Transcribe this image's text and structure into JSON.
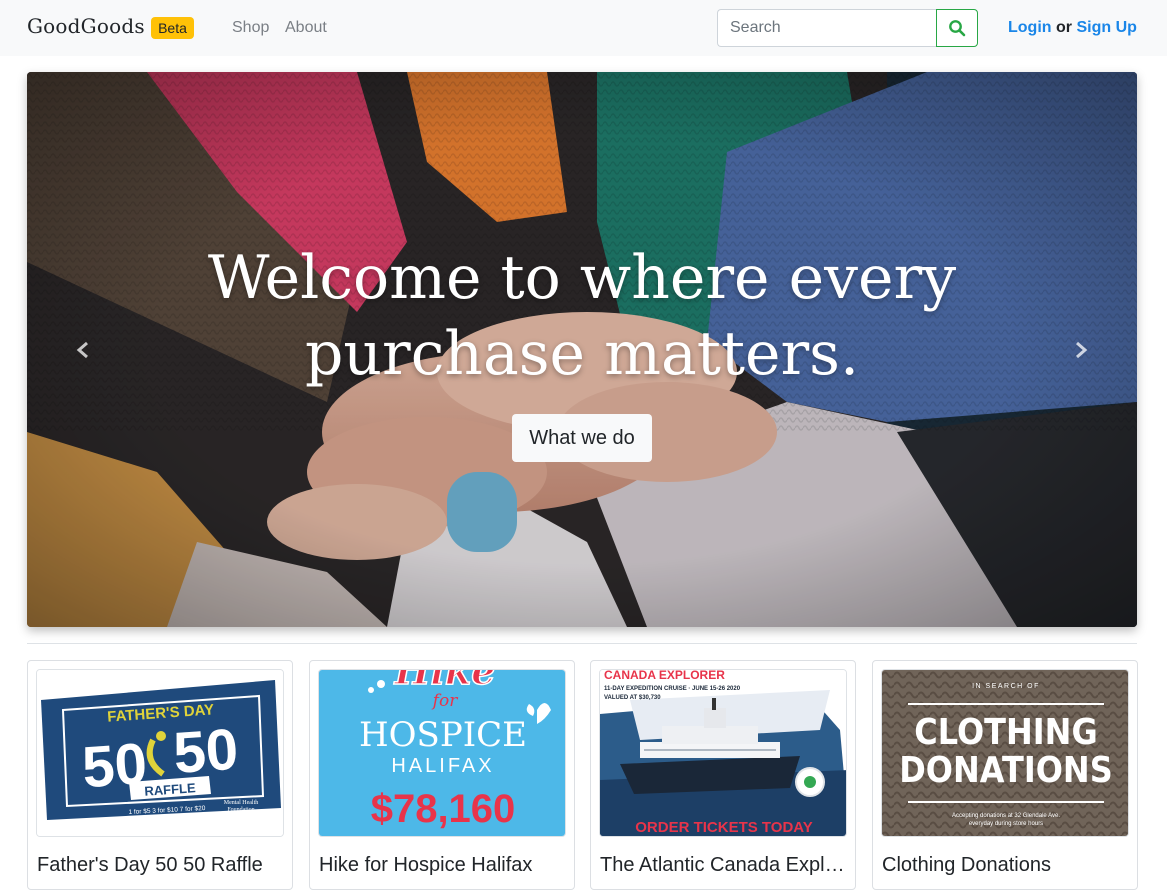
{
  "brand": {
    "name": "GoodGoods",
    "badge": "Beta"
  },
  "nav": {
    "items": [
      {
        "label": "Shop"
      },
      {
        "label": "About"
      }
    ]
  },
  "search": {
    "placeholder": "Search",
    "value": "",
    "button_icon": "search-icon"
  },
  "auth": {
    "login": "Login",
    "or": "or",
    "signup": "Sign Up"
  },
  "hero": {
    "title_line1": "Welcome to where every",
    "title_line2": "purchase matters.",
    "button": "What we do",
    "prev_icon": "chevron-left-icon",
    "next_icon": "chevron-right-icon"
  },
  "products": [
    {
      "title": "Father's Day 50 50 Raffle",
      "thumb": {
        "heading": "FATHER'S DAY",
        "big_left": "50",
        "big_right": "50",
        "ribbon": "RAFFLE",
        "prices": "1 for $5   3 for $10   7 for $20",
        "org_line1": "Mental Health",
        "org_line2": "Foundation"
      }
    },
    {
      "title": "Hike for Hospice Halifax",
      "thumb": {
        "script": "Hike",
        "for": "for",
        "line1": "HOSPICE",
        "line2": "HALIFAX",
        "amount": "$78,160"
      }
    },
    {
      "title": "The Atlantic Canada Explorer",
      "thumb": {
        "heading": "CANADA EXPLORER",
        "line1": "11-DAY EXPEDITION CRUISE · JUNE 15-26 2020",
        "line2": "VALUED AT $30,730",
        "footer": "ORDER TICKETS TODAY"
      }
    },
    {
      "title": "Clothing Donations",
      "thumb": {
        "top": "IN SEARCH OF",
        "line1": "CLOTHING",
        "line2": "DONATIONS",
        "note1": "Accepting donations at 32 Glendale Ave.",
        "note2": "everyday during store hours"
      }
    }
  ],
  "colors": {
    "navbar_bg": "#f8f9fa",
    "badge": "#ffc107",
    "link": "#1a86e8",
    "search_button_border": "#28a745",
    "hospice_blue": "#4db8e8",
    "hospice_red": "#e8344a",
    "raffle_navy": "#1f4a7c",
    "raffle_yellow": "#e0d33a"
  }
}
